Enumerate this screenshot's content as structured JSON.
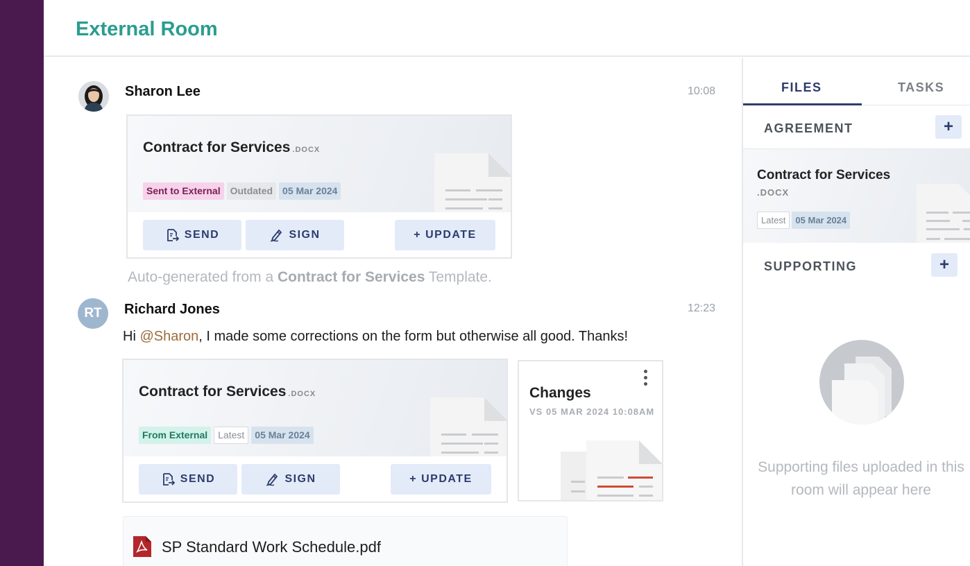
{
  "header": {
    "title": "External Room"
  },
  "messages": [
    {
      "sender": "Sharon Lee",
      "time": "10:08",
      "card": {
        "title": "Contract for Services",
        "ext": ".DOCX",
        "tags": [
          "Sent to External",
          "Outdated",
          "05 Mar 2024"
        ],
        "buttons": {
          "send": "SEND",
          "sign": "SIGN",
          "update": "+ UPDATE"
        }
      },
      "note": {
        "prefix": "Auto-generated from a ",
        "bold": "Contract for Services",
        "suffix": " Template."
      }
    },
    {
      "sender": "Richard Jones",
      "initials": "RT",
      "time": "12:23",
      "text": {
        "prefix": "Hi ",
        "mention": "@Sharon",
        "suffix": ", I made some corrections on the form but otherwise all good. Thanks!"
      },
      "card": {
        "title": "Contract for Services",
        "ext": ".DOCX",
        "tags": [
          "From External",
          "Latest",
          "05 Mar 2024"
        ],
        "buttons": {
          "send": "SEND",
          "sign": "SIGN",
          "update": "+ UPDATE"
        }
      },
      "changes": {
        "title": "Changes",
        "subtitle": "VS 05 MAR 2024 10:08AM"
      },
      "attachment": {
        "name": "SP Standard Work Schedule.pdf"
      }
    }
  ],
  "rightpanel": {
    "tabs": [
      "FILES",
      "TASKS"
    ],
    "agreement": {
      "label": "AGREEMENT",
      "plus": "+",
      "card": {
        "title": "Contract for Services",
        "ext": ".DOCX",
        "tags": [
          "Latest",
          "05 Mar 2024"
        ]
      }
    },
    "supporting": {
      "label": "SUPPORTING",
      "plus": "+",
      "empty_text": "Supporting files uploaded in this room will appear here"
    }
  },
  "colors": {
    "sidebar": "#4a1a4f",
    "title": "#2a9d8f",
    "button_bg": "#e3ebf9",
    "button_text": "#2c3c6c",
    "mention": "#9c6a3c"
  },
  "icons": [
    "send-doc-icon",
    "sign-pen-icon",
    "pdf-icon",
    "kebab-menu-icon",
    "stacked-files-icon"
  ]
}
